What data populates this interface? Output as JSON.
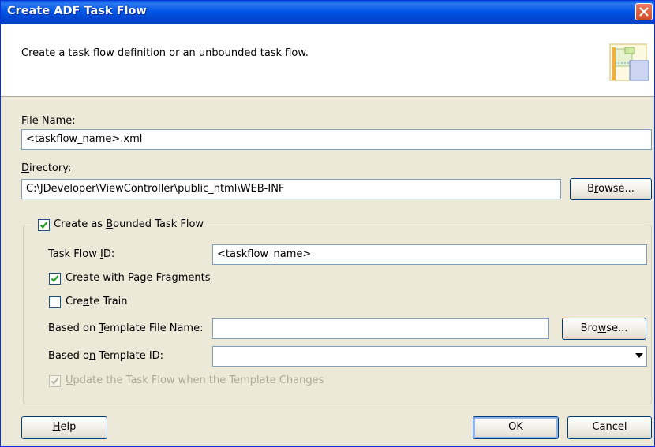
{
  "window": {
    "title": "Create ADF Task Flow"
  },
  "header": {
    "description": "Create a task flow definition or an unbounded task flow.",
    "logo_icon": "task-flow-logo-icon"
  },
  "file_name": {
    "label_mnemonic": "F",
    "label_rest": "ile Name:",
    "value": "<taskflow_name>.xml"
  },
  "directory": {
    "label_mnemonic": "D",
    "label_rest": "irectory:",
    "value": "C:\\JDeveloper\\ViewController\\public_html\\WEB-INF",
    "browse_pre": "B",
    "browse_mnemonic": "r",
    "browse_post": "owse..."
  },
  "bounded": {
    "pre": "Create as ",
    "mnemonic": "B",
    "post": "ounded Task Flow",
    "checked": true,
    "task_flow_id": {
      "pre": "Task Flow ",
      "mnemonic": "I",
      "post": "D:",
      "value": "<taskflow_name>"
    },
    "page_fragments": {
      "pre": "Create with Page Fragments",
      "checked": true
    },
    "create_train": {
      "pre": "Cre",
      "mnemonic": "a",
      "post": "te Train",
      "checked": false
    },
    "template_file": {
      "pre": "Based on ",
      "mnemonic": "T",
      "post": "emplate File Name:",
      "value": "",
      "browse_pre": "Bro",
      "browse_mnemonic": "w",
      "browse_post": "se..."
    },
    "template_id": {
      "pre": "Based o",
      "mnemonic": "n",
      "post": " Template ID:",
      "value": ""
    },
    "update_flow": {
      "mnemonic": "U",
      "post": "pdate the Task Flow when the Template Changes",
      "checked": true,
      "enabled": false
    }
  },
  "footer": {
    "help_mnemonic": "H",
    "help_post": "elp",
    "ok_label": "OK",
    "cancel_label": "Cancel"
  },
  "colors": {
    "titlebar": "#0055e5",
    "dialog_bg": "#ece9d8",
    "check_mark": "#21a121"
  }
}
